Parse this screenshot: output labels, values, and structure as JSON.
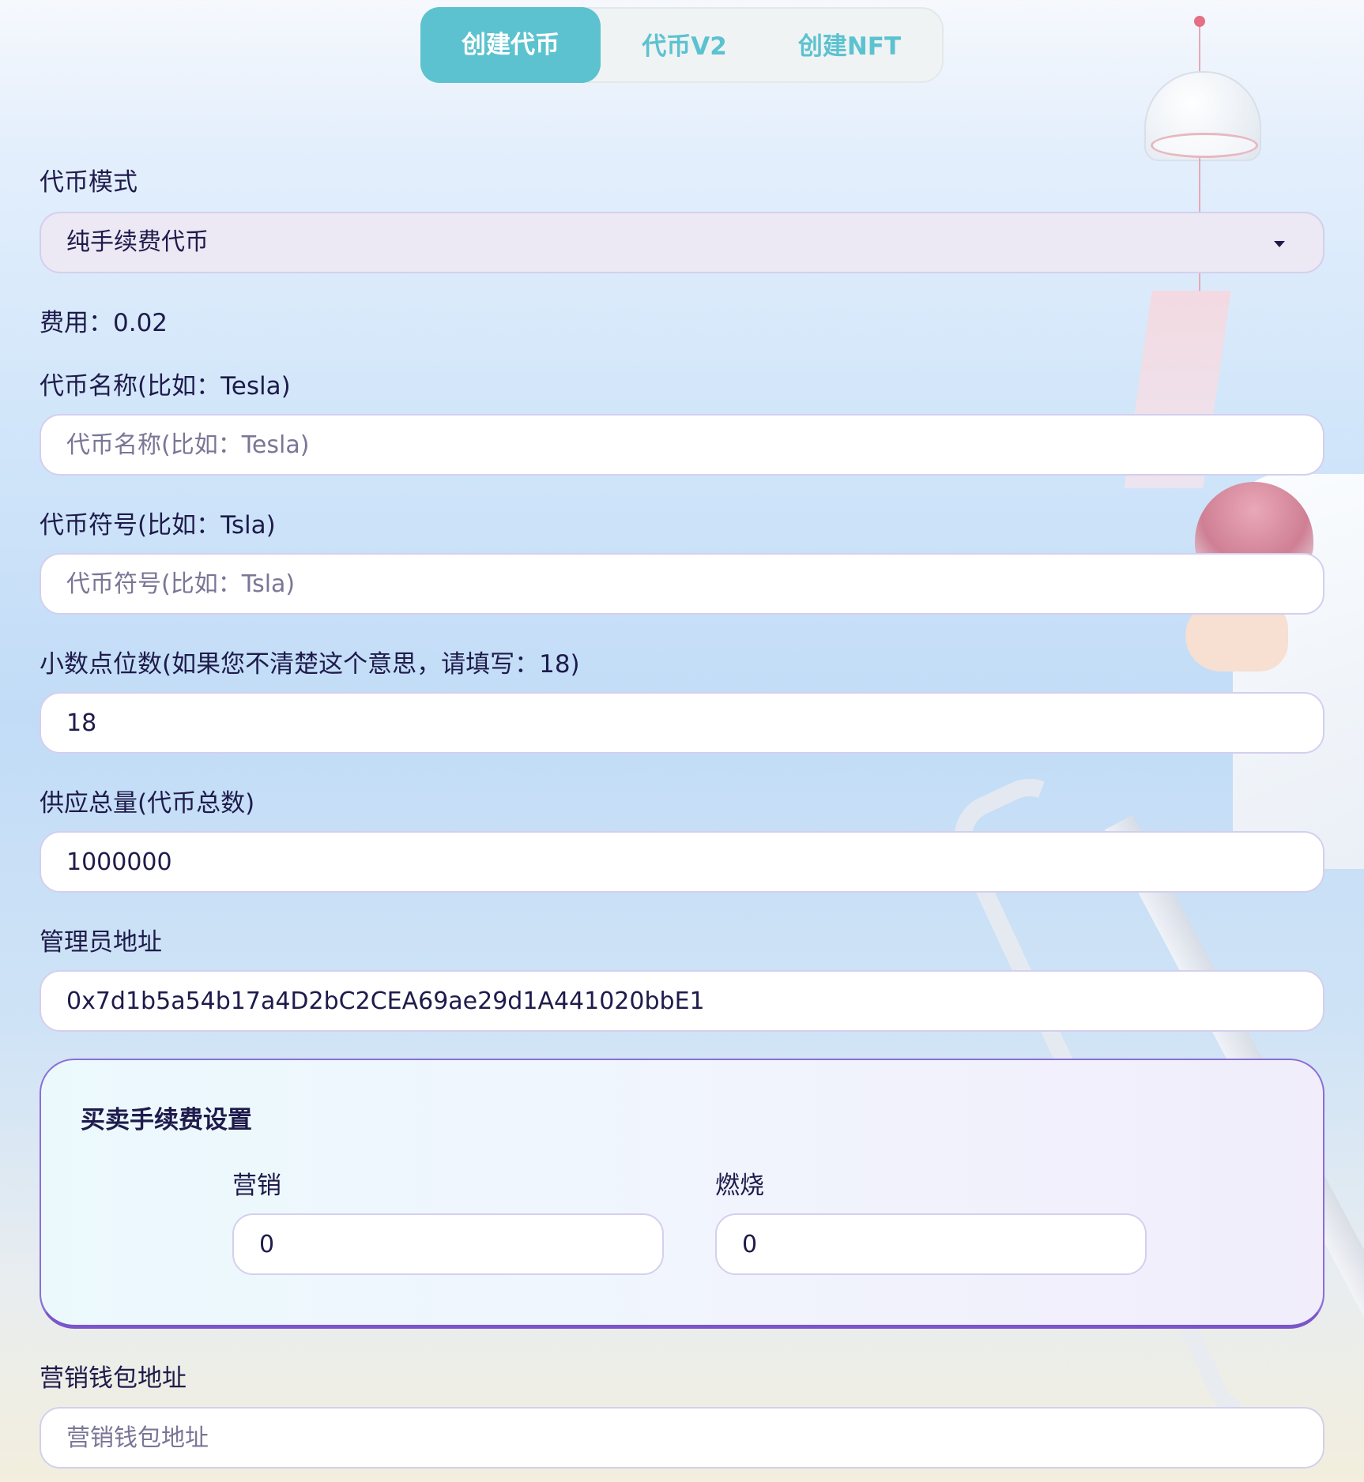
{
  "tabs": [
    {
      "label": "创建代币",
      "active": true
    },
    {
      "label": "代币V2",
      "active": false
    },
    {
      "label": "创建NFT",
      "active": false
    }
  ],
  "token_mode": {
    "label": "代币模式",
    "selected": "纯手续费代币"
  },
  "fee": {
    "text": "费用：0.02"
  },
  "token_name": {
    "label": "代币名称(比如：Tesla)",
    "placeholder": "代币名称(比如：Tesla)",
    "value": ""
  },
  "token_symbol": {
    "label": "代币符号(比如：Tsla)",
    "placeholder": "代币符号(比如：Tsla)",
    "value": ""
  },
  "decimals": {
    "label": "小数点位数(如果您不清楚这个意思，请填写：18)",
    "value": "18"
  },
  "total_supply": {
    "label": "供应总量(代币总数)",
    "value": "1000000"
  },
  "admin_address": {
    "label": "管理员地址",
    "value": "0x7d1b5a54b17a4D2bC2CEA69ae29d1A441020bbE1"
  },
  "trade_fee_settings": {
    "title": "买卖手续费设置",
    "marketing": {
      "label": "营销",
      "value": "0"
    },
    "burn": {
      "label": "燃烧",
      "value": "0"
    }
  },
  "marketing_wallet": {
    "label": "营销钱包地址",
    "placeholder": "营销钱包地址",
    "value": ""
  },
  "colors": {
    "accent": "#5cc2cf",
    "text": "#1e1b4b",
    "panel_border": "#7b55c9",
    "input_border": "#d4cfee"
  }
}
